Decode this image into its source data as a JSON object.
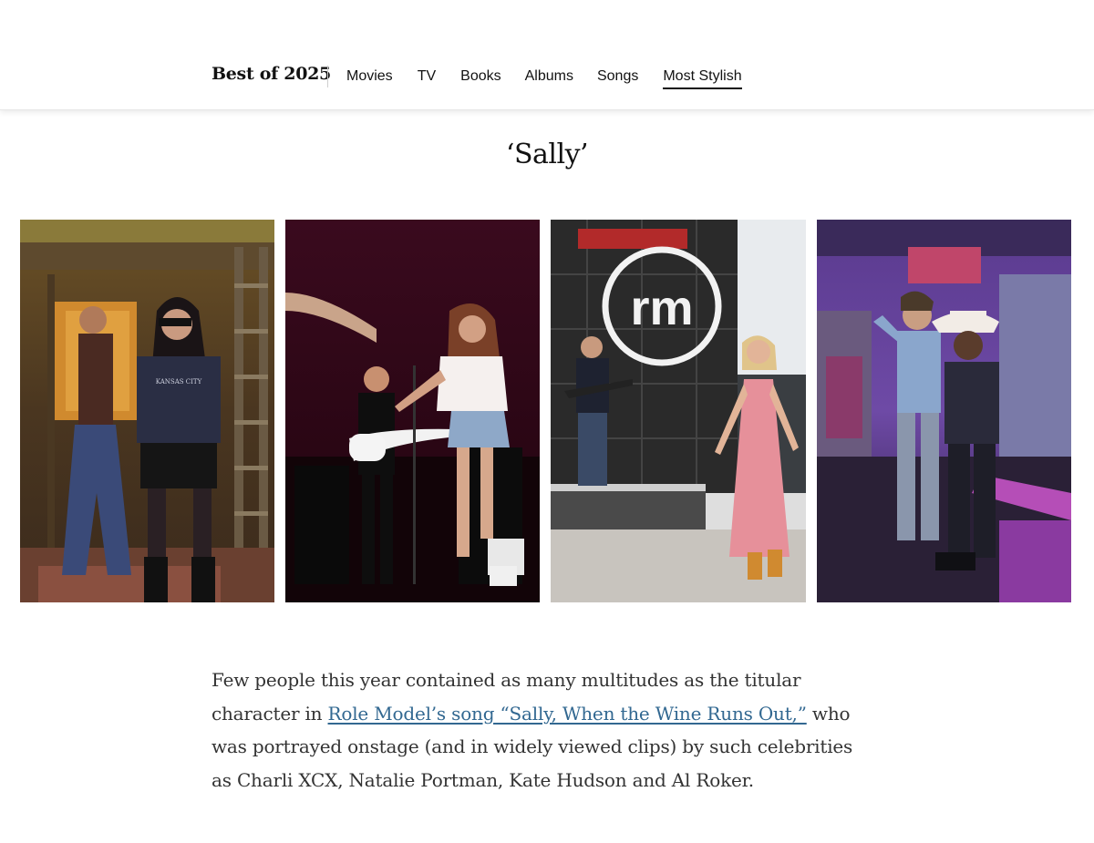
{
  "nav": {
    "brand": "Best of 2025",
    "links": [
      {
        "label": "Movies",
        "active": false
      },
      {
        "label": "TV",
        "active": false
      },
      {
        "label": "Books",
        "active": false
      },
      {
        "label": "Albums",
        "active": false
      },
      {
        "label": "Songs",
        "active": false
      },
      {
        "label": "Most Stylish",
        "active": true
      }
    ]
  },
  "section": {
    "title": "‘Sally’"
  },
  "photos": [
    {
      "shirt_text": "KANSAS CITY"
    },
    {},
    {
      "sign_text": "rm"
    },
    {}
  ],
  "article": {
    "text_before": "Few people this year contained as many multitudes as the titular character in ",
    "link_text": "Role Model’s song “Sally, When the Wine Runs Out,”",
    "text_after": " who was portrayed onstage (and in widely viewed clips) by such celebrities as Charli XCX, Natalie Portman, Kate Hudson and Al Roker."
  },
  "colors": {
    "link": "#326891",
    "body_text": "#333333",
    "nav_text": "#121212"
  }
}
